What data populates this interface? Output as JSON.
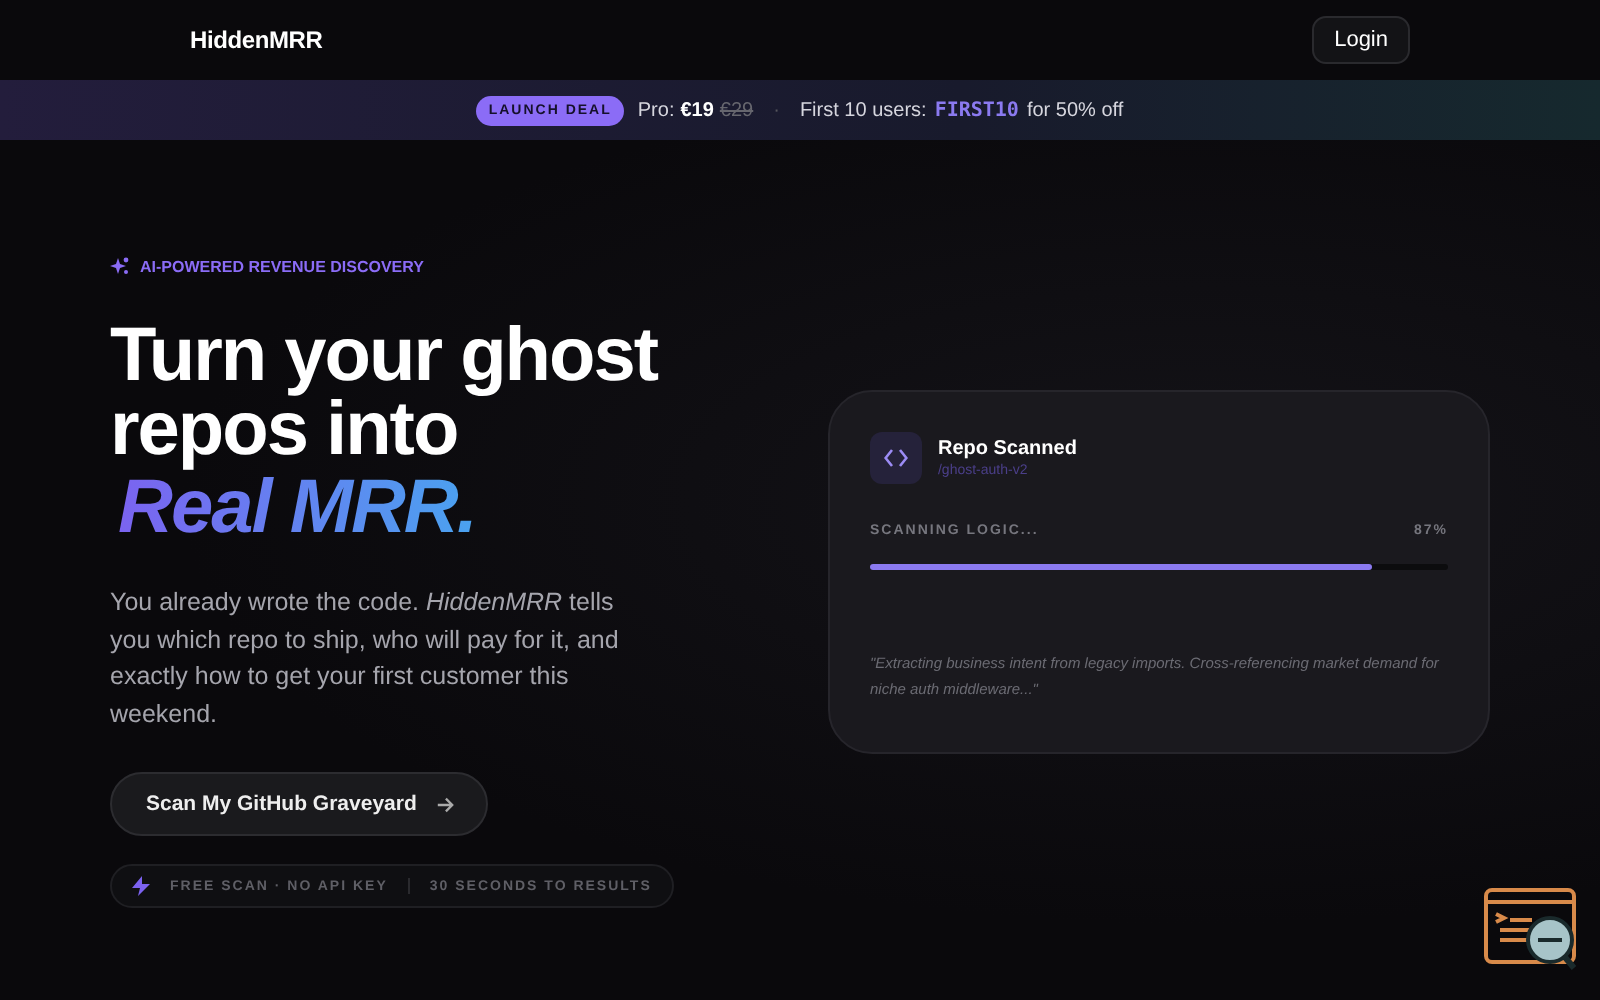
{
  "header": {
    "logo": "HiddenMRR",
    "login": "Login"
  },
  "banner": {
    "badge": "LAUNCH DEAL",
    "pro_label": "Pro:",
    "price": "€19",
    "old_price": "€29",
    "separator": "·",
    "offer_label": "First 10 users:",
    "code": "FIRST10",
    "offer_suffix": "for 50% off"
  },
  "hero": {
    "eyebrow": "AI-POWERED REVENUE DISCOVERY",
    "title": "Turn your ghost repos into",
    "title_accent": "Real MRR.",
    "description": "You already wrote the code. *HiddenMRR* tells you which repo to ship, who will pay for it, and exactly how to get your first customer this weekend.",
    "cta": "Scan My GitHub Graveyard",
    "features": [
      "FREE SCAN · NO API KEY",
      "30 SECONDS TO RESULTS"
    ]
  },
  "scan_card": {
    "title": "Repo Scanned",
    "repo": "/ghost-auth-v2",
    "status": "SCANNING LOGIC...",
    "level": 0.87,
    "reading": "87%",
    "quote": "\"Extracting business intent from legacy imports. Cross-referencing market demand for niche auth middleware...\""
  }
}
